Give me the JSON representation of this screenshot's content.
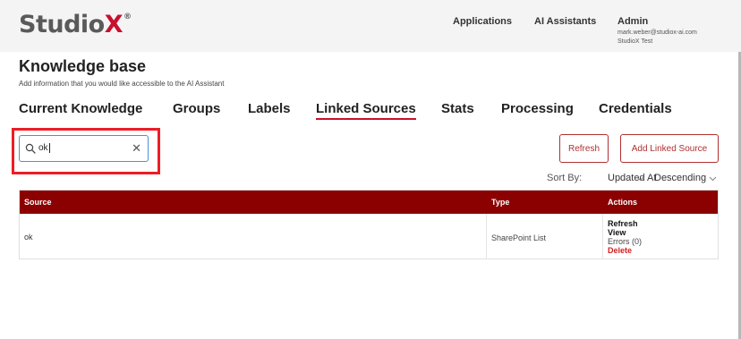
{
  "header": {
    "logo_main": "Studio",
    "logo_x": "X",
    "logo_reg": "®",
    "nav": [
      "Applications",
      "AI Assistants"
    ],
    "admin": {
      "title": "Admin",
      "email": "mark.weber@studiox-ai.com",
      "org": "StudioX Test"
    }
  },
  "page": {
    "title": "Knowledge base",
    "subtitle": "Add information that you would like accessible to the AI Assistant"
  },
  "tabs": [
    {
      "label": "Current Knowledge",
      "active": false
    },
    {
      "label": "Groups",
      "active": false
    },
    {
      "label": "Labels",
      "active": false
    },
    {
      "label": "Linked Sources",
      "active": true
    },
    {
      "label": "Stats",
      "active": false
    },
    {
      "label": "Processing",
      "active": false
    },
    {
      "label": "Credentials",
      "active": false
    }
  ],
  "search": {
    "value": "ok",
    "icon": "search-icon",
    "clear_icon": "close-icon"
  },
  "buttons": {
    "refresh": "Refresh",
    "add_linked_source": "Add Linked Source"
  },
  "sort": {
    "label": "Sort By:",
    "field": "Updated At",
    "direction": "Descending"
  },
  "table": {
    "columns": [
      "Source",
      "Type",
      "Actions"
    ],
    "rows": [
      {
        "source": "ok",
        "type": "SharePoint List",
        "actions": {
          "refresh": "Refresh",
          "view": "View",
          "errors": "Errors (0)",
          "delete": "Delete"
        }
      }
    ]
  },
  "colors": {
    "brand_red": "#c8102e",
    "table_header": "#8b0000",
    "highlight": "#ee1c25"
  }
}
